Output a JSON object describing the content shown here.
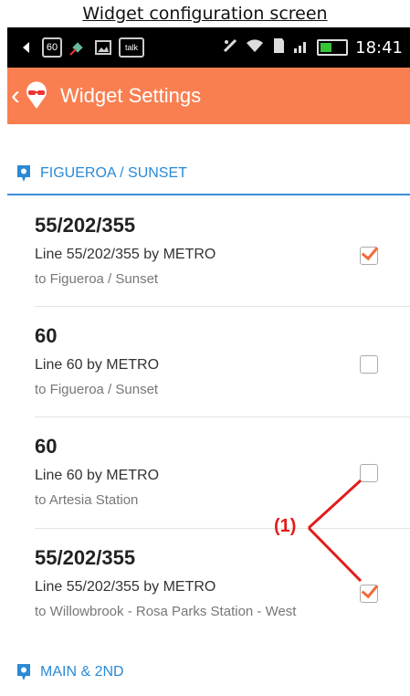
{
  "caption": "Widget configuration screen",
  "status_bar": {
    "left_icons": [
      "back-arrow-icon",
      "60-badge-icon",
      "satellite-icon",
      "gallery-icon",
      "talk-icon"
    ],
    "badge_text": "60",
    "talk_text": "talk",
    "time": "18:41"
  },
  "action_bar": {
    "title": "Widget Settings",
    "background_color": "#f97f51"
  },
  "sections": [
    {
      "title": "FIGUEROA / SUNSET",
      "routes": [
        {
          "name": "55/202/355",
          "line": "Line 55/202/355  by METRO",
          "destination": "to Figueroa / Sunset",
          "checked": true
        },
        {
          "name": "60",
          "line": "Line 60  by METRO",
          "destination": "to Figueroa / Sunset",
          "checked": false
        },
        {
          "name": "60",
          "line": "Line 60  by METRO",
          "destination": "to Artesia Station",
          "checked": false
        },
        {
          "name": "55/202/355",
          "line": "Line 55/202/355  by METRO",
          "destination": "to Willowbrook - Rosa Parks Station - West",
          "checked": true
        }
      ]
    },
    {
      "title": "MAIN & 2ND",
      "routes": []
    }
  ],
  "annotation": "(1)",
  "colors": {
    "accent": "#f26b3a",
    "section_blue": "#2a8ad6",
    "annotation_red": "#e31b1b"
  }
}
